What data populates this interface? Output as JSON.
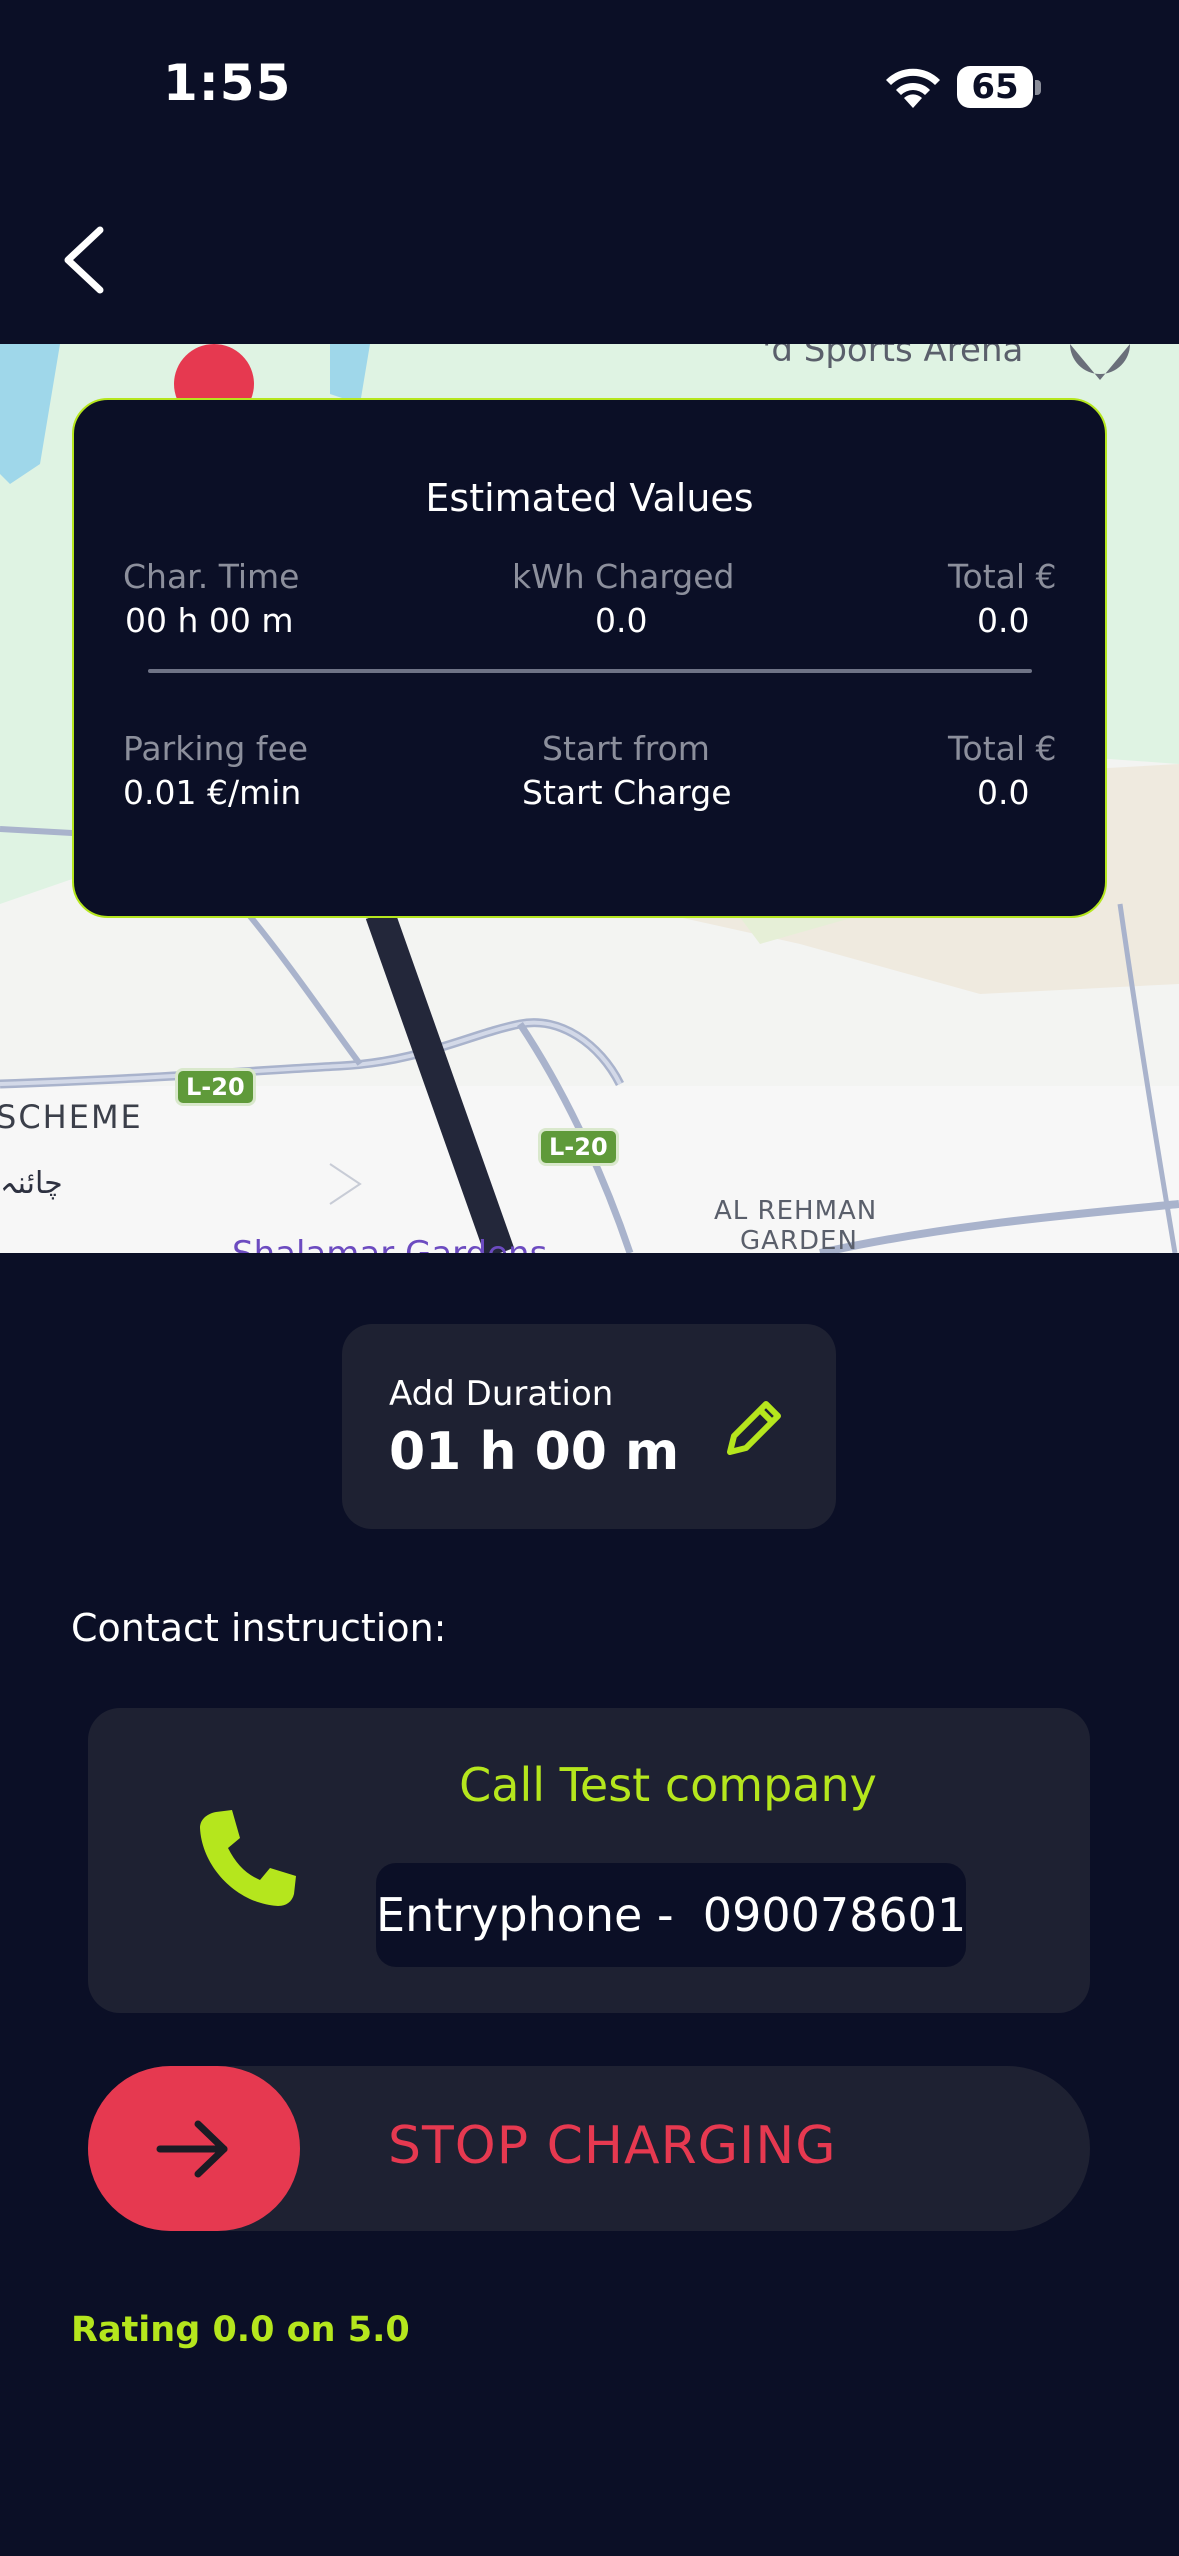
{
  "status_bar": {
    "time": "1:55",
    "battery": "65",
    "icons": [
      "wifi-icon",
      "battery-icon"
    ]
  },
  "header": {
    "back_icon": "chevron-left-icon"
  },
  "map": {
    "labels": {
      "arena": "'d Sports Arena",
      "scheme": "SCHEME",
      "urdu": "چائنہ",
      "al_rehman_1": "AL REHMAN",
      "al_rehman_2": "GARDEN",
      "shalamar": "Shalamar Gardens",
      "road_1": "L-20",
      "road_2": "L-20"
    }
  },
  "estimated": {
    "title": "Estimated Values",
    "row1": {
      "char_time_label": "Char. Time",
      "char_time_value": "00 h 00 m",
      "kwh_label": "kWh Charged",
      "kwh_value": "0.0",
      "total_label": "Total €",
      "total_value": "0.0"
    },
    "row2": {
      "parking_label": "Parking fee",
      "parking_value": "0.01 €/min",
      "start_label": "Start from",
      "start_value": "Start Charge",
      "total_label": "Total €",
      "total_value": "0.0"
    }
  },
  "duration": {
    "label": "Add Duration",
    "value": "01 h 00 m",
    "icon": "pencil-icon"
  },
  "contact": {
    "heading": "Contact instruction:",
    "call_title": "Call Test company",
    "phone_text": "Entryphone -  090078601",
    "icon": "phone-icon"
  },
  "stop": {
    "label": "STOP CHARGING",
    "icon": "arrow-right-icon"
  },
  "rating": "Rating 0.0 on 5.0",
  "colors": {
    "background": "#0b0f26",
    "card": "#1e2132",
    "accent": "#b5e61d",
    "danger": "#e63950"
  }
}
